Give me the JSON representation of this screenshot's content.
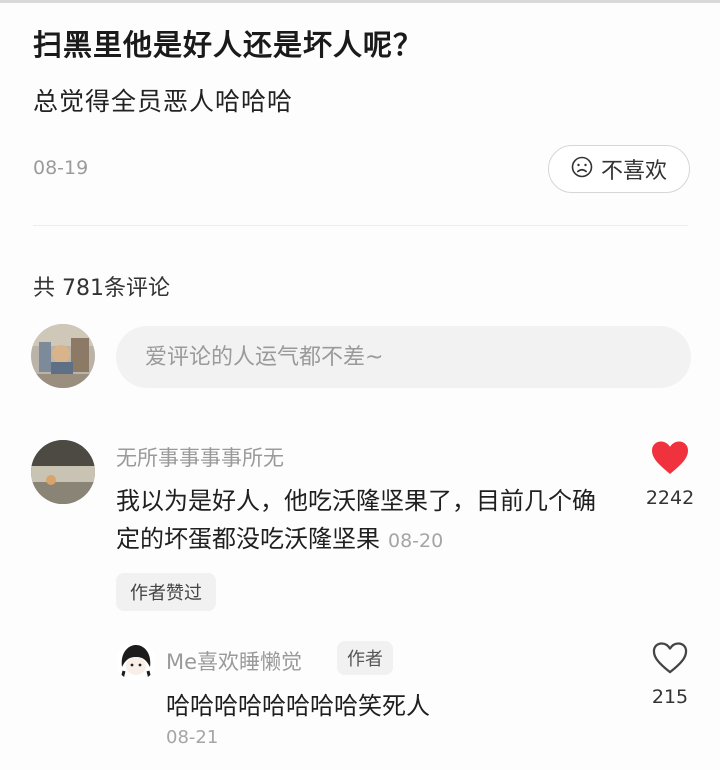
{
  "post": {
    "title": "扫黑里他是好人还是坏人呢？",
    "body": "总觉得全员恶人哈哈哈",
    "date": "08-19",
    "dislike_label": "不喜欢"
  },
  "comments_section": {
    "count_label": "共 781条评论",
    "input_placeholder": "爱评论的人运气都不差~"
  },
  "comments": [
    {
      "username": "无所事事事事所无",
      "text": "我以为是好人，他吃沃隆坚果了，目前几个确定的坏蛋都没吃沃隆坚果",
      "date": "08-20",
      "badge": "作者赞过",
      "likes": "2242",
      "liked": true
    }
  ],
  "reply": {
    "username": "Me喜欢睡懒觉",
    "author_tag": "作者",
    "text": "哈哈哈哈哈哈哈哈笑死人",
    "date": "08-21",
    "likes": "215",
    "liked": false
  },
  "colors": {
    "accent_like": "#f0323f",
    "muted_text": "#9a9a9a",
    "input_bg": "#f2f2f2"
  },
  "icons": {
    "dislike": "sad-face-icon",
    "like_filled": "heart-filled-icon",
    "like_outline": "heart-outline-icon"
  }
}
